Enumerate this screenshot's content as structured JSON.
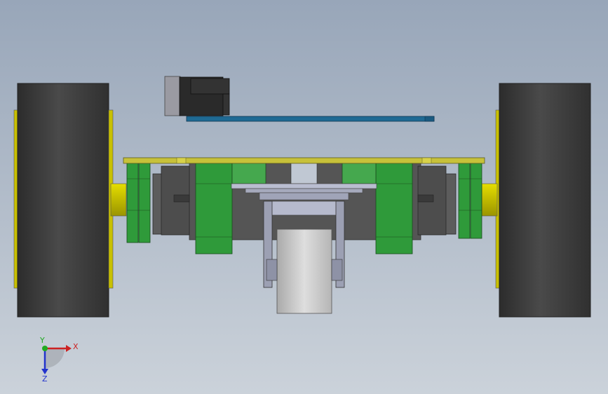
{
  "viewport": {
    "background_top": "#98a6b9",
    "background_bottom": "#cbd2da"
  },
  "model": {
    "parts": [
      {
        "id": "left-wheel",
        "color": "#3c3c3c",
        "rim_color": "#c8c000"
      },
      {
        "id": "right-wheel",
        "color": "#3c3c3c",
        "rim_color": "#c8c000"
      },
      {
        "id": "chassis-plate",
        "color": "#c7c13a"
      },
      {
        "id": "motor-mounts",
        "color": "#2f9a3a"
      },
      {
        "id": "caster-wheel",
        "color": "#c8c8c8"
      },
      {
        "id": "controller-board",
        "color": "#1f5f8a"
      },
      {
        "id": "stepper-motor",
        "color": "#2b2b2b"
      }
    ]
  },
  "triad": {
    "x_label": "X",
    "y_label": "Y",
    "z_label": "Z",
    "x_color": "#cc2222",
    "y_color": "#22aa22",
    "z_color": "#2233cc"
  }
}
